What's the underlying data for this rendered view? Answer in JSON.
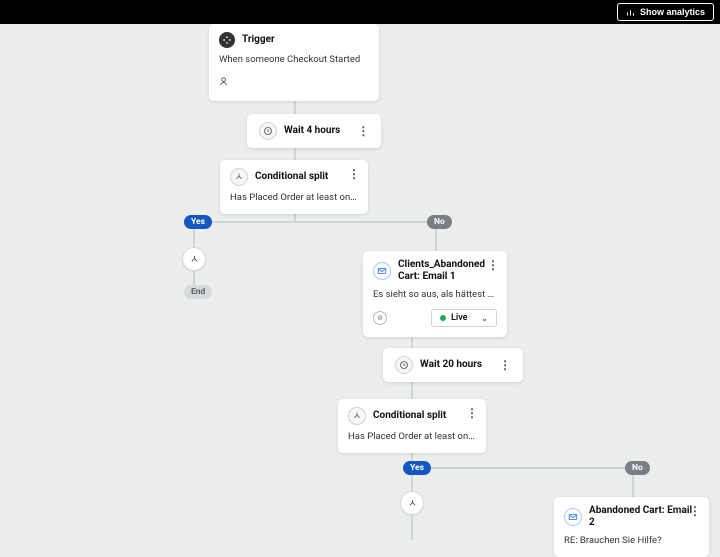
{
  "topbar": {
    "show_analytics": "Show analytics"
  },
  "trigger": {
    "title": "Trigger",
    "desc": "When someone Checkout Started"
  },
  "wait1": {
    "title": "Wait 4 hours"
  },
  "split1": {
    "title": "Conditional split",
    "desc": "Has Placed Order at least once in the last…"
  },
  "badges1": {
    "yes": "Yes",
    "no": "No",
    "end": "End"
  },
  "email1": {
    "title": "Clients_Abandoned Cart: Email 1",
    "desc": "Es sieht so aus, als hättest du etwas zurü…",
    "status": "Live"
  },
  "wait2": {
    "title": "Wait 20 hours"
  },
  "split2": {
    "title": "Conditional split",
    "desc": "Has Placed Order at least once in the last…"
  },
  "badges2": {
    "yes": "Yes",
    "no": "No"
  },
  "email2": {
    "title": "Abandoned Cart: Email 2",
    "desc": "RE: Brauchen Sie Hilfe?"
  },
  "chart_data": {
    "type": "flow",
    "nodes": [
      {
        "id": "trigger",
        "kind": "trigger",
        "label": "Trigger",
        "detail": "When someone Checkout Started"
      },
      {
        "id": "wait1",
        "kind": "wait",
        "label": "Wait 4 hours"
      },
      {
        "id": "split1",
        "kind": "conditional",
        "label": "Conditional split",
        "detail": "Has Placed Order at least once in the last…"
      },
      {
        "id": "end1",
        "kind": "end",
        "label": "End"
      },
      {
        "id": "email1",
        "kind": "email",
        "label": "Clients_Abandoned Cart: Email 1",
        "detail": "Es sieht so aus, als hättest du etwas zurü…",
        "status": "Live"
      },
      {
        "id": "wait2",
        "kind": "wait",
        "label": "Wait 20 hours"
      },
      {
        "id": "split2",
        "kind": "conditional",
        "label": "Conditional split",
        "detail": "Has Placed Order at least once in the last…"
      },
      {
        "id": "email2",
        "kind": "email",
        "label": "Abandoned Cart: Email 2",
        "detail": "RE: Brauchen Sie Hilfe?"
      }
    ],
    "edges": [
      {
        "from": "trigger",
        "to": "wait1"
      },
      {
        "from": "wait1",
        "to": "split1"
      },
      {
        "from": "split1",
        "to": "end1",
        "label": "Yes"
      },
      {
        "from": "split1",
        "to": "email1",
        "label": "No"
      },
      {
        "from": "email1",
        "to": "wait2"
      },
      {
        "from": "wait2",
        "to": "split2"
      },
      {
        "from": "split2",
        "to": "?",
        "label": "Yes"
      },
      {
        "from": "split2",
        "to": "email2",
        "label": "No"
      }
    ]
  }
}
